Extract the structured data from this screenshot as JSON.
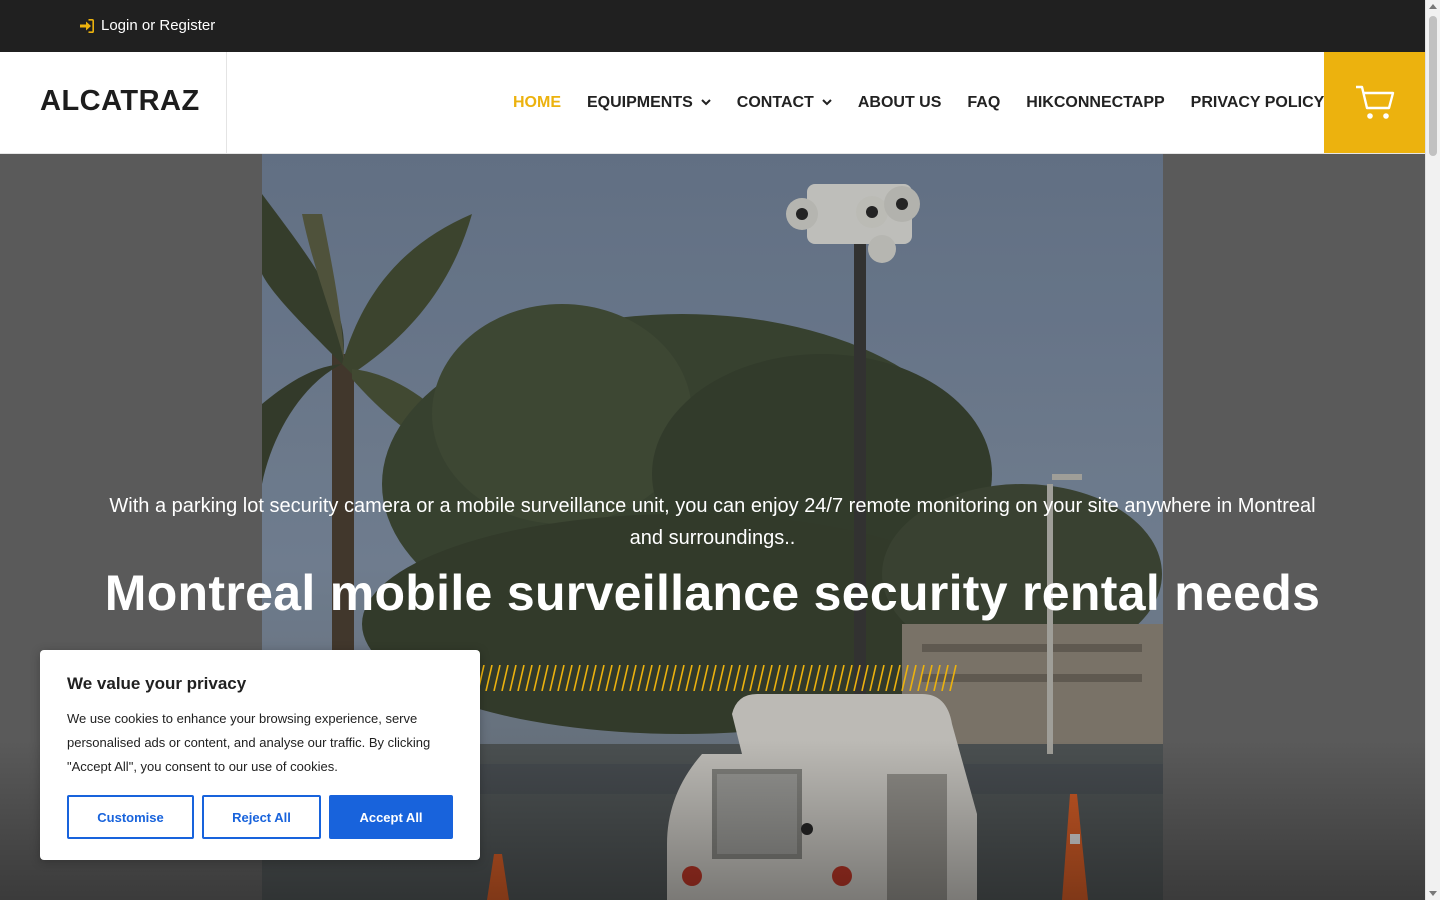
{
  "topbar": {
    "login_label": "Login or Register",
    "login_icon": "sign-in-icon"
  },
  "header": {
    "logo": "ALCATRAZ",
    "nav": [
      {
        "label": "HOME",
        "active": true,
        "has_dropdown": false
      },
      {
        "label": "EQUIPMENTS",
        "active": false,
        "has_dropdown": true
      },
      {
        "label": "CONTACT",
        "active": false,
        "has_dropdown": true
      },
      {
        "label": "ABOUT US",
        "active": false,
        "has_dropdown": false
      },
      {
        "label": "FAQ",
        "active": false,
        "has_dropdown": false
      },
      {
        "label": "HIKCONNECTAPP",
        "active": false,
        "has_dropdown": false
      },
      {
        "label": "PRIVACY POLICY",
        "active": false,
        "has_dropdown": false
      }
    ],
    "cart_icon": "shopping-cart-icon"
  },
  "hero": {
    "subtitle": "With a parking lot security camera or a mobile surveillance unit, you can enjoy 24/7 remote monitoring on your site anywhere in Montreal and surroundings..",
    "title": "Montreal mobile surveillance security rental needs"
  },
  "cookie_banner": {
    "title": "We value your privacy",
    "text": "We use cookies to enhance your browsing experience, serve personalised ads or content, and analyse our traffic. By clicking \"Accept All\", you consent to our use of cookies.",
    "customise_label": "Customise",
    "reject_label": "Reject All",
    "accept_label": "Accept All"
  },
  "colors": {
    "accent": "#ecb20e",
    "topbar": "#202020",
    "cookie_button": "#1863dc"
  }
}
